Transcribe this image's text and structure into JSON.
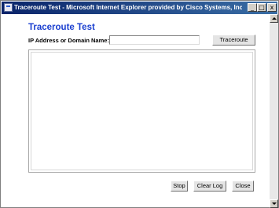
{
  "window": {
    "title": "Traceroute Test - Microsoft Internet Explorer provided by Cisco Systems, Inc.",
    "minimize_label": "_",
    "maximize_label": "□",
    "close_label": "x"
  },
  "page": {
    "title": "Traceroute Test"
  },
  "form": {
    "ip_label": "IP Address or Domain Name:",
    "ip_value": "",
    "traceroute_button": "Traceroute"
  },
  "log": {
    "content": ""
  },
  "actions": {
    "stop": "Stop",
    "clear_log": "Clear Log",
    "close": "Close"
  },
  "colors": {
    "title_blue": "#1a3fd0",
    "titlebar": "#0a246a"
  }
}
